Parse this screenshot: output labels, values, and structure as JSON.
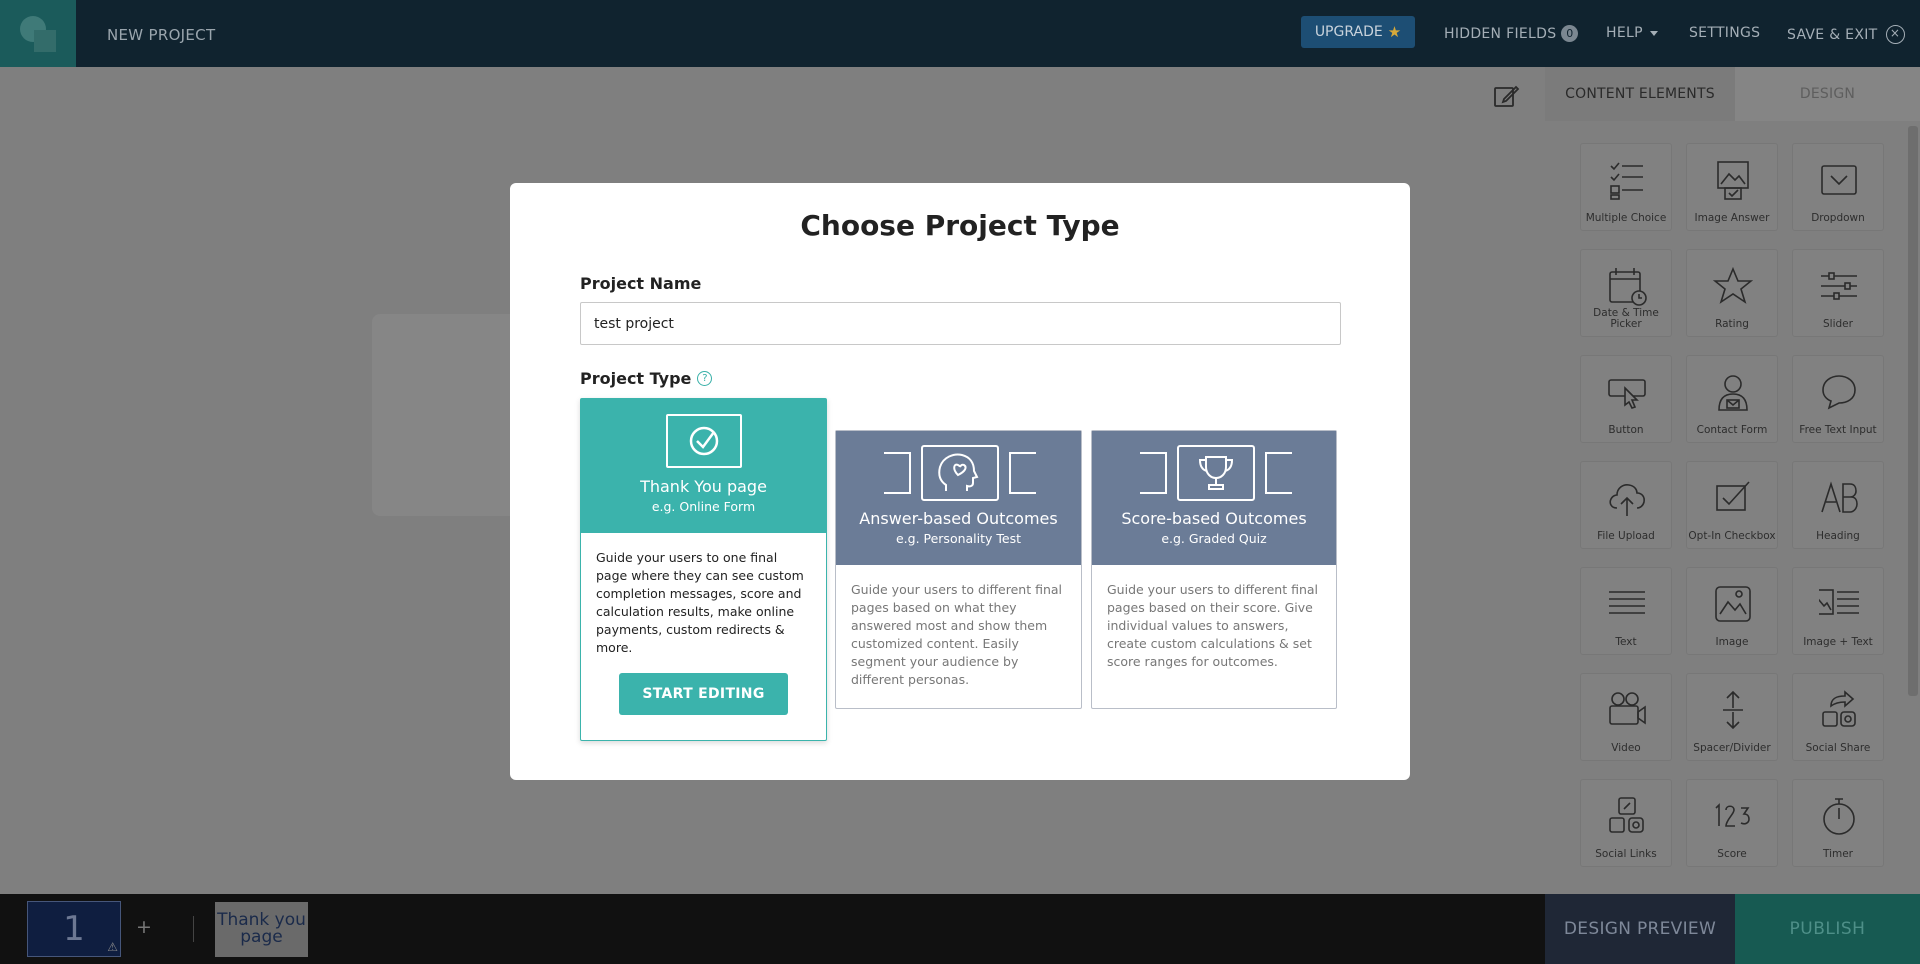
{
  "topbar": {
    "project_title": "NEW PROJECT",
    "upgrade_label": "UPGRADE",
    "hidden_fields_label": "HIDDEN FIELDS",
    "hidden_fields_count": "0",
    "help_label": "HELP",
    "settings_label": "SETTINGS",
    "save_exit_label": "SAVE & EXIT"
  },
  "panel": {
    "tab_content": "CONTENT ELEMENTS",
    "tab_design": "DESIGN",
    "elements": [
      {
        "label": "Multiple Choice",
        "icon": "multiple-choice-icon"
      },
      {
        "label": "Image Answer",
        "icon": "image-answer-icon"
      },
      {
        "label": "Dropdown",
        "icon": "dropdown-icon"
      },
      {
        "label": "Date & Time Picker",
        "icon": "calendar-icon"
      },
      {
        "label": "Rating",
        "icon": "star-icon"
      },
      {
        "label": "Slider",
        "icon": "slider-icon"
      },
      {
        "label": "Button",
        "icon": "cursor-icon"
      },
      {
        "label": "Contact Form",
        "icon": "contact-icon"
      },
      {
        "label": "Free Text Input",
        "icon": "speech-bubble-icon"
      },
      {
        "label": "File Upload",
        "icon": "cloud-upload-icon"
      },
      {
        "label": "Opt-In Checkbox",
        "icon": "checkbox-icon"
      },
      {
        "label": "Heading",
        "icon": "heading-icon"
      },
      {
        "label": "Text",
        "icon": "text-lines-icon"
      },
      {
        "label": "Image",
        "icon": "image-icon"
      },
      {
        "label": "Image + Text",
        "icon": "image-text-icon"
      },
      {
        "label": "Video",
        "icon": "video-camera-icon"
      },
      {
        "label": "Spacer/Divider",
        "icon": "spacer-icon"
      },
      {
        "label": "Social Share",
        "icon": "share-icon"
      },
      {
        "label": "Social Links",
        "icon": "social-links-icon"
      },
      {
        "label": "Score",
        "icon": "score-icon"
      },
      {
        "label": "Timer",
        "icon": "timer-icon"
      }
    ]
  },
  "modal": {
    "title": "Choose Project Type",
    "name_label": "Project Name",
    "name_value": "test project",
    "type_label": "Project Type",
    "cards": [
      {
        "title": "Thank You page",
        "subtitle": "e.g. Online Form",
        "description": "Guide your users to one final page where they can see custom completion messages, score and calculation results, make online payments, custom redirects & more.",
        "button": "START EDITING"
      },
      {
        "title": "Answer-based Outcomes",
        "subtitle": "e.g. Personality Test",
        "description": "Guide your users to different final pages based on what they answered most and show them customized content. Easily segment your audience by different personas."
      },
      {
        "title": "Score-based Outcomes",
        "subtitle": "e.g. Graded Quiz",
        "description": "Guide your users to different final pages based on their score. Give individual values to answers, create custom calculations & set score ranges for outcomes."
      }
    ]
  },
  "bottombar": {
    "page_number": "1",
    "add_label": "+",
    "thank_you_thumb": "Thank you page",
    "design_preview": "DESIGN PREVIEW",
    "publish": "PUBLISH"
  },
  "colors": {
    "accent": "#3bb3ac",
    "card_header": "#6b7c97",
    "topbar": "#10232f"
  }
}
